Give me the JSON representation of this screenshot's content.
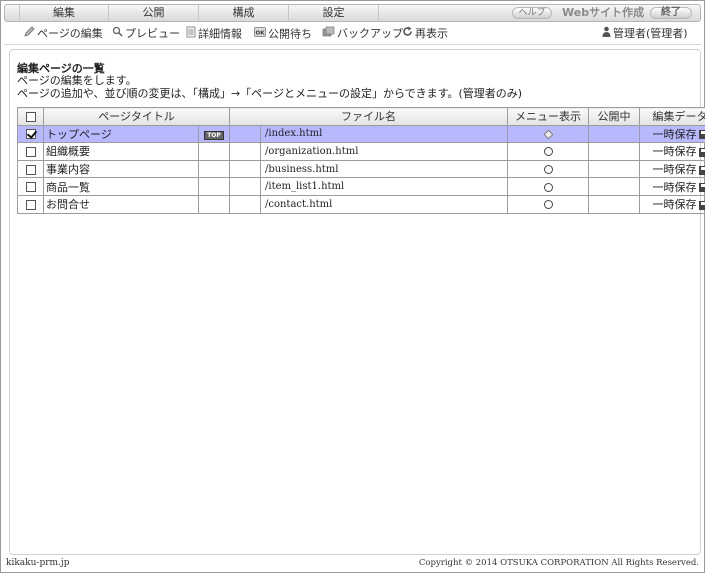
{
  "menu": {
    "items": [
      "編集",
      "公開",
      "構成",
      "設定"
    ],
    "help_label": "ヘルプ",
    "app_title": "Webサイト作成",
    "exit_label": "終了"
  },
  "toolbar": {
    "items": [
      {
        "label": "ページの編集",
        "icon": "pencil-icon"
      },
      {
        "label": "プレビュー",
        "icon": "magnifier-icon"
      },
      {
        "label": "詳細情報",
        "icon": "document-icon"
      },
      {
        "label": "公開待ち",
        "icon": "ok-icon"
      },
      {
        "label": "バックアップ",
        "icon": "backup-icon"
      },
      {
        "label": "再表示",
        "icon": "refresh-icon"
      }
    ],
    "user_label": "管理者(管理者)"
  },
  "main": {
    "title": "編集ページの一覧",
    "description_1": "ページの編集をします。",
    "description_2": "ページの追加や、並び順の変更は、「構成」→「ページとメニューの設定」からできます。(管理者のみ)"
  },
  "table": {
    "headers": {
      "page_title": "ページタイトル",
      "file_name": "ファイル名",
      "menu_display": "メニュー表示",
      "published": "公開中",
      "edit_data": "編集データ"
    },
    "rows": [
      {
        "title": "トップページ",
        "badge": "TOP",
        "file": "/index.html",
        "menu": "diamond",
        "save": "一時保存",
        "checked": true,
        "selected": true
      },
      {
        "title": "組織概要",
        "badge": "",
        "file": "/organization.html",
        "menu": "radio",
        "save": "一時保存",
        "checked": false,
        "selected": false
      },
      {
        "title": "事業内容",
        "badge": "",
        "file": "/business.html",
        "menu": "radio",
        "save": "一時保存",
        "checked": false,
        "selected": false
      },
      {
        "title": "商品一覧",
        "badge": "",
        "file": "/item_list1.html",
        "menu": "radio",
        "save": "一時保存",
        "checked": false,
        "selected": false
      },
      {
        "title": "お問合せ",
        "badge": "",
        "file": "/contact.html",
        "menu": "radio",
        "save": "一時保存",
        "checked": false,
        "selected": false
      }
    ]
  },
  "footer": {
    "left": "kikaku-prm.jp",
    "right": "Copyright © 2014 OTSUKA CORPORATION All Rights Reserved."
  },
  "colors": {
    "selected_row": "#b8b8ff",
    "header_bg": "#e3e3e3"
  }
}
